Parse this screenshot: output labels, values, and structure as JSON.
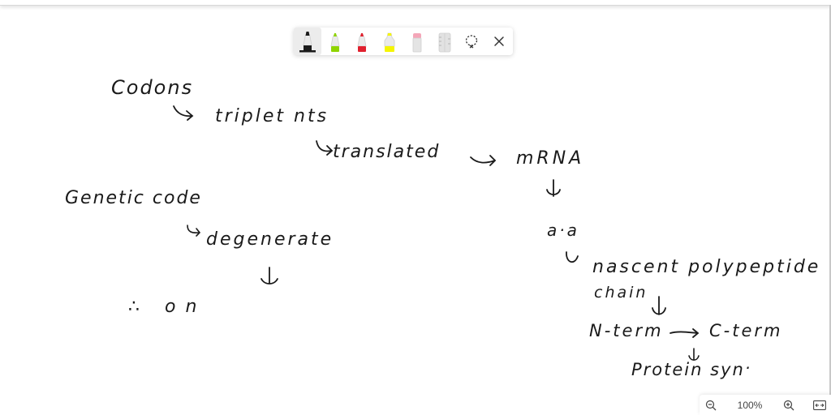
{
  "toolbar": {
    "tools": [
      {
        "name": "black-marker",
        "color": "#1a1a1a",
        "active": true
      },
      {
        "name": "green-marker",
        "color": "#8fd400",
        "active": false
      },
      {
        "name": "red-marker",
        "color": "#e0202e",
        "active": false
      },
      {
        "name": "yellow-highlighter",
        "color": "#f5f500",
        "active": false
      },
      {
        "name": "eraser",
        "color": "#f4a6b8",
        "active": false
      },
      {
        "name": "ruler",
        "color": "#cfcfcf",
        "active": false
      },
      {
        "name": "lasso-select",
        "active": false
      },
      {
        "name": "close",
        "active": false
      }
    ]
  },
  "notes": {
    "codons": "Codons",
    "triplet_nts": "triplet nts",
    "translated": "translated",
    "mrna": "mRNA",
    "genetic_code": "Genetic code",
    "degenerate": "degenerate",
    "therefore_on": "∴ on",
    "aa": "a·a",
    "nascent_polypeptide": "nascent polypeptide",
    "chain": "chain",
    "n_term": "N-term",
    "c_term": "C-term",
    "protein_syn": "Protein syn",
    "dot": "·"
  },
  "zoom": {
    "level": "100%"
  }
}
